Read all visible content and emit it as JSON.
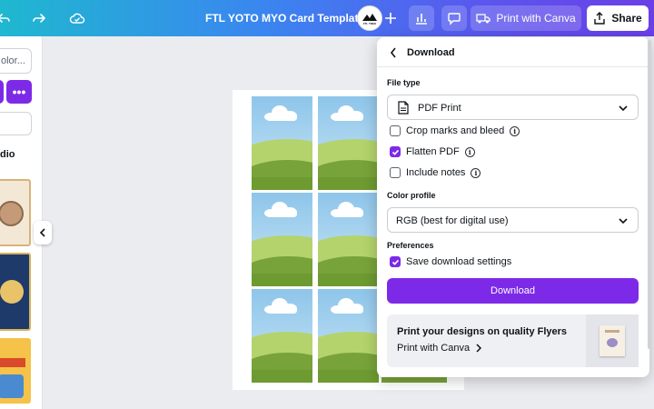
{
  "topbar": {
    "title": "FTL YOTO MYO Card Template",
    "avatar_text": "FTL TREK",
    "print_label": "Print with Canva",
    "share_label": "Share",
    "icons": [
      "undo-icon",
      "redo-icon",
      "cloud-saved-icon",
      "plus-icon",
      "insights-chart-icon",
      "comment-icon",
      "truck-icon",
      "upload-icon"
    ]
  },
  "left_panel": {
    "search_text": "olor...",
    "more_label": "•••",
    "section_label": "dio"
  },
  "download": {
    "title": "Download",
    "file_type_label": "File type",
    "file_type_value": "PDF Print",
    "options": [
      {
        "label": "Crop marks and bleed",
        "checked": false
      },
      {
        "label": "Flatten PDF",
        "checked": true
      },
      {
        "label": "Include notes",
        "checked": false
      }
    ],
    "color_profile_label": "Color profile",
    "color_profile_value": "RGB (best for digital use)",
    "preferences_label": "Preferences",
    "save_settings_label": "Save download settings",
    "save_settings_checked": true,
    "download_button": "Download",
    "promo_title": "Print your designs on quality Flyers",
    "promo_link": "Print with Canva"
  },
  "colors": {
    "accent": "#7d2ae8",
    "topbar_gradient": [
      "#1fb8cf",
      "#3a86f0",
      "#6a3fe6"
    ]
  }
}
